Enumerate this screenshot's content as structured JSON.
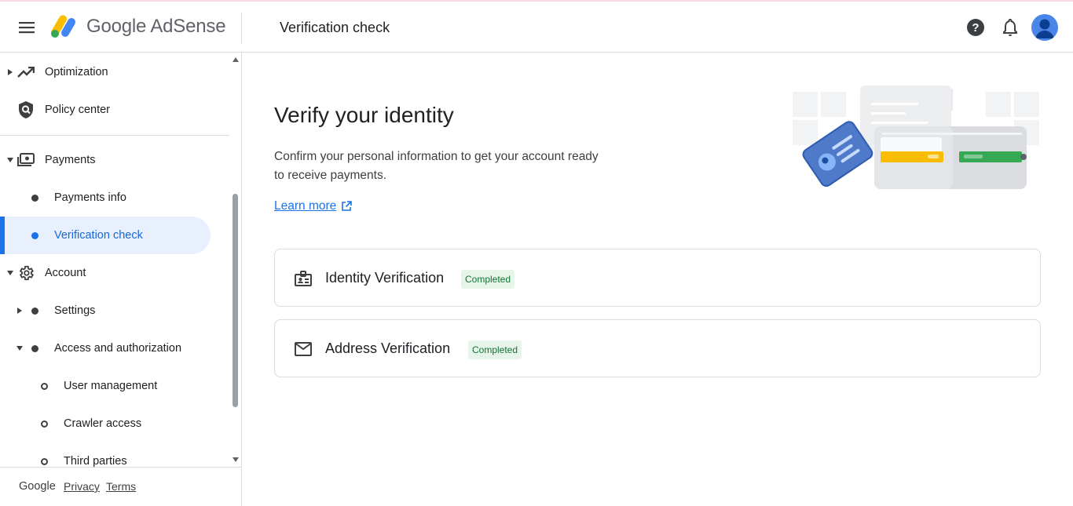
{
  "header": {
    "brand": "Google AdSense",
    "page_title": "Verification check",
    "icons": [
      "menu-icon",
      "adsense-logo",
      "help-icon",
      "notifications-icon",
      "avatar"
    ]
  },
  "sidebar": {
    "items": [
      {
        "label": "Optimization",
        "icon": "trending-up-icon",
        "expandable": true,
        "expanded": false
      },
      {
        "label": "Policy center",
        "icon": "shield-icon"
      },
      {
        "label": "Payments",
        "icon": "payments-icon",
        "expandable": true,
        "expanded": true
      },
      {
        "label": "Payments info",
        "level": 2
      },
      {
        "label": "Verification check",
        "level": 2,
        "active": true
      },
      {
        "label": "Account",
        "icon": "gear-icon",
        "expandable": true,
        "expanded": true
      },
      {
        "label": "Settings",
        "level": 2,
        "expandable": true,
        "expanded": false
      },
      {
        "label": "Access and authorization",
        "level": 2,
        "expandable": true,
        "expanded": true
      },
      {
        "label": "User management",
        "level": 3
      },
      {
        "label": "Crawler access",
        "level": 3
      },
      {
        "label": "Third parties",
        "level": 3
      }
    ],
    "footer": {
      "google": "Google",
      "privacy": "Privacy",
      "terms": "Terms"
    }
  },
  "main": {
    "heading": "Verify your identity",
    "description": "Confirm your personal information to get your account ready to receive payments.",
    "learn_more": "Learn more",
    "cards": [
      {
        "title": "Identity Verification",
        "status": "Completed",
        "icon": "badge-icon"
      },
      {
        "title": "Address Verification",
        "status": "Completed",
        "icon": "mail-icon"
      }
    ]
  },
  "colors": {
    "accent": "#1a73e8",
    "active_bg": "#e8f0fe",
    "completed_bg": "#e6f4ea",
    "completed_text": "#137333",
    "border": "#dadce0"
  }
}
